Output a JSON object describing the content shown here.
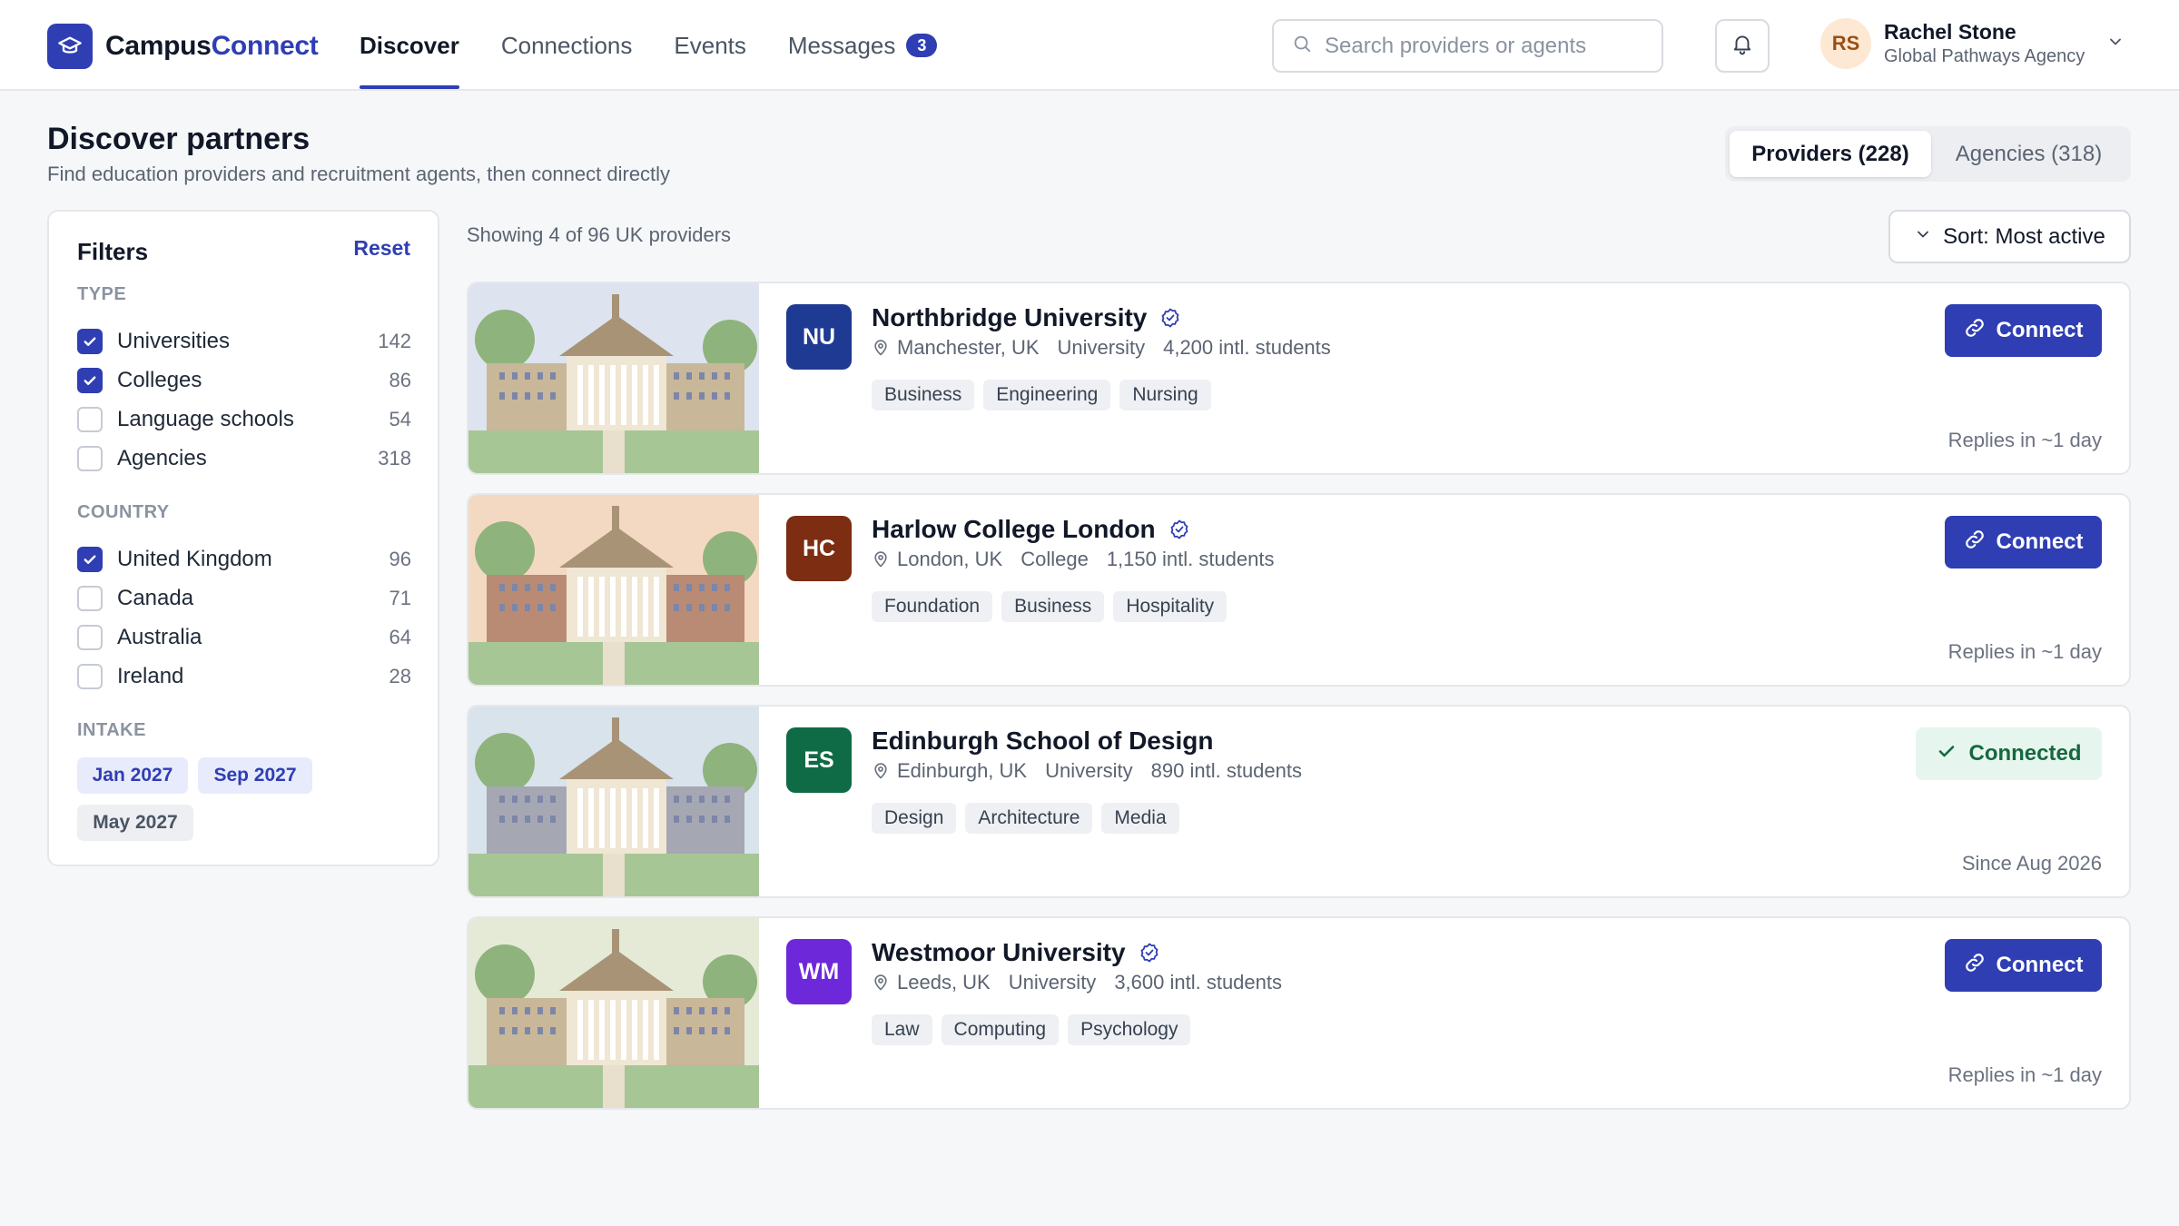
{
  "app": {
    "name_part1": "Campus",
    "name_part2": "Connect",
    "brand_color": "#2f3eb3"
  },
  "nav": {
    "items": [
      {
        "label": "Discover",
        "active": true
      },
      {
        "label": "Connections",
        "active": false
      },
      {
        "label": "Events",
        "active": false
      },
      {
        "label": "Messages",
        "active": false,
        "badge": "3"
      }
    ]
  },
  "search": {
    "placeholder": "Search providers or agents",
    "value": ""
  },
  "user": {
    "initials": "RS",
    "name": "Rachel Stone",
    "org": "Global Pathways Agency"
  },
  "header": {
    "title": "Discover partners",
    "subtitle": "Find education providers and recruitment agents, then connect directly",
    "tabs": [
      {
        "label": "Providers (228)",
        "active": true
      },
      {
        "label": "Agencies (318)",
        "active": false
      }
    ]
  },
  "filters": {
    "title": "Filters",
    "reset_label": "Reset",
    "type": {
      "label": "TYPE",
      "options": [
        {
          "label": "Universities",
          "count": "142",
          "checked": true
        },
        {
          "label": "Colleges",
          "count": "86",
          "checked": true
        },
        {
          "label": "Language schools",
          "count": "54",
          "checked": false
        },
        {
          "label": "Agencies",
          "count": "318",
          "checked": false
        }
      ]
    },
    "country": {
      "label": "COUNTRY",
      "options": [
        {
          "label": "United Kingdom",
          "count": "96",
          "checked": true
        },
        {
          "label": "Canada",
          "count": "71",
          "checked": false
        },
        {
          "label": "Australia",
          "count": "64",
          "checked": false
        },
        {
          "label": "Ireland",
          "count": "28",
          "checked": false
        }
      ]
    },
    "intake": {
      "label": "INTAKE",
      "chips": [
        {
          "label": "Jan 2027",
          "selected": true
        },
        {
          "label": "Sep 2027",
          "selected": true
        },
        {
          "label": "May 2027",
          "selected": false
        }
      ]
    }
  },
  "results": {
    "showing": "Showing 4 of 96 UK providers",
    "sort_label": "Sort: Most active",
    "cards": [
      {
        "initials": "NU",
        "badge_color": "#1f3a93",
        "name": "Northbridge University",
        "verified": true,
        "location": "Manchester, UK",
        "type": "University",
        "students": "4,200 intl. students",
        "tags": [
          "Business",
          "Engineering",
          "Nursing"
        ],
        "action": "Connect",
        "connected": false,
        "footer": "Replies in ~1 day",
        "sky": "#dde4ef",
        "wall": "#c9b79a"
      },
      {
        "initials": "HC",
        "badge_color": "#7c2d12",
        "name": "Harlow College London",
        "verified": true,
        "location": "London, UK",
        "type": "College",
        "students": "1,150 intl. students",
        "tags": [
          "Foundation",
          "Business",
          "Hospitality"
        ],
        "action": "Connect",
        "connected": false,
        "footer": "Replies in ~1 day",
        "sky": "#f4d9c2",
        "wall": "#b98b74"
      },
      {
        "initials": "ES",
        "badge_color": "#0f6b46",
        "name": "Edinburgh School of Design",
        "verified": false,
        "location": "Edinburgh, UK",
        "type": "University",
        "students": "890 intl. students",
        "tags": [
          "Design",
          "Architecture",
          "Media"
        ],
        "action": "Connected",
        "connected": true,
        "footer": "Since Aug 2026",
        "sky": "#d9e3ec",
        "wall": "#a5a8b3"
      },
      {
        "initials": "WM",
        "badge_color": "#6d28d9",
        "name": "Westmoor University",
        "verified": true,
        "location": "Leeds, UK",
        "type": "University",
        "students": "3,600 intl. students",
        "tags": [
          "Law",
          "Computing",
          "Psychology"
        ],
        "action": "Connect",
        "connected": false,
        "footer": "Replies in ~1 day",
        "sky": "#e5ead6",
        "wall": "#c9b79a"
      }
    ]
  }
}
